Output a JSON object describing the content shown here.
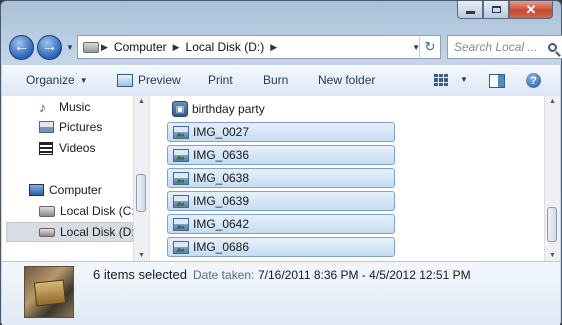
{
  "window": {
    "caption_buttons": [
      "minimize-icon",
      "maximize-icon",
      "close-icon"
    ],
    "close_glyph": "✕"
  },
  "nav": {
    "back_glyph": "←",
    "forward_glyph": "→",
    "breadcrumb": [
      "Computer",
      "Local Disk (D:)"
    ],
    "search_placeholder": "Search Local ..."
  },
  "toolbar": {
    "organize": "Organize",
    "preview": "Preview",
    "print": "Print",
    "burn": "Burn",
    "new_folder": "New folder",
    "help_glyph": "?"
  },
  "sidebar": {
    "items": [
      {
        "label": "Music",
        "icon": "music-icon"
      },
      {
        "label": "Pictures",
        "icon": "pictures-icon"
      },
      {
        "label": "Videos",
        "icon": "videos-icon"
      },
      {
        "label": "Computer",
        "icon": "computer-icon"
      },
      {
        "label": "Local Disk (C:)",
        "icon": "drive-icon"
      },
      {
        "label": "Local Disk (D:)",
        "icon": "drive-icon",
        "selected": true
      }
    ]
  },
  "files": [
    {
      "name": "birthday party",
      "selected": false,
      "icon": "slideshow-icon"
    },
    {
      "name": "IMG_0027",
      "selected": true,
      "icon": "image-icon"
    },
    {
      "name": "IMG_0636",
      "selected": true,
      "icon": "image-icon"
    },
    {
      "name": "IMG_0638",
      "selected": true,
      "icon": "image-icon"
    },
    {
      "name": "IMG_0639",
      "selected": true,
      "icon": "image-icon"
    },
    {
      "name": "IMG_0642",
      "selected": true,
      "icon": "image-icon"
    },
    {
      "name": "IMG_0686",
      "selected": true,
      "icon": "image-icon"
    }
  ],
  "details": {
    "selection_text": "6 items selected",
    "date_label": "Date taken:",
    "date_value": "7/16/2011 8:36 PM - 4/5/2012 12:51 PM"
  },
  "colors": {
    "selection": "#c6dcf3",
    "selection_border": "#7da2ce",
    "toolbar_text": "#1e395b"
  }
}
